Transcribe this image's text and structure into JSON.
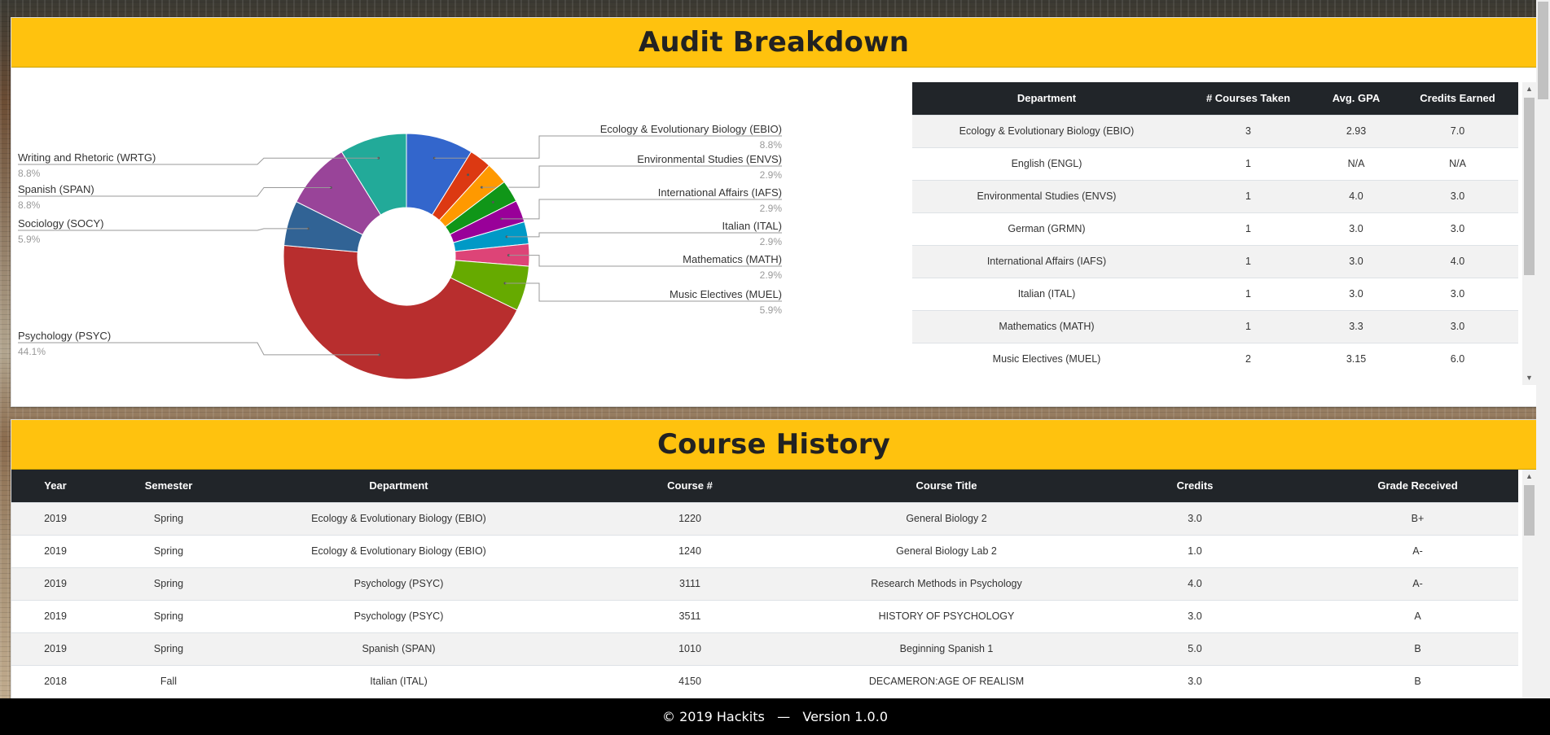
{
  "audit": {
    "title": "Audit Breakdown",
    "table": {
      "headers": [
        "Department",
        "# Courses Taken",
        "Avg. GPA",
        "Credits Earned"
      ],
      "rows": [
        [
          "Ecology & Evolutionary Biology (EBIO)",
          "3",
          "2.93",
          "7.0"
        ],
        [
          "English (ENGL)",
          "1",
          "N/A",
          "N/A"
        ],
        [
          "Environmental Studies (ENVS)",
          "1",
          "4.0",
          "3.0"
        ],
        [
          "German (GRMN)",
          "1",
          "3.0",
          "3.0"
        ],
        [
          "International Affairs (IAFS)",
          "1",
          "3.0",
          "4.0"
        ],
        [
          "Italian (ITAL)",
          "1",
          "3.0",
          "3.0"
        ],
        [
          "Mathematics (MATH)",
          "1",
          "3.3",
          "3.0"
        ],
        [
          "Music Electives (MUEL)",
          "2",
          "3.15",
          "6.0"
        ]
      ]
    }
  },
  "chart_data": {
    "type": "pie",
    "donut": true,
    "title": "",
    "legend": "none",
    "slices": [
      {
        "name": "Ecology & Evolutionary Biology (EBIO)",
        "label": "8.8%",
        "value": 8.8,
        "color": "#3366cc",
        "side": "right",
        "show_label": true
      },
      {
        "name": "English (ENGL)",
        "label": "2.9%",
        "value": 2.9,
        "color": "#dc3912",
        "side": "right",
        "show_label": false
      },
      {
        "name": "Environmental Studies (ENVS)",
        "label": "2.9%",
        "value": 2.9,
        "color": "#ff9900",
        "side": "right",
        "show_label": true
      },
      {
        "name": "German (GRMN)",
        "label": "2.9%",
        "value": 2.9,
        "color": "#109618",
        "side": "right",
        "show_label": false
      },
      {
        "name": "International Affairs (IAFS)",
        "label": "2.9%",
        "value": 2.9,
        "color": "#990099",
        "side": "right",
        "show_label": true
      },
      {
        "name": "Italian (ITAL)",
        "label": "2.9%",
        "value": 2.9,
        "color": "#0099c6",
        "side": "right",
        "show_label": true
      },
      {
        "name": "Mathematics (MATH)",
        "label": "2.9%",
        "value": 2.9,
        "color": "#dd4477",
        "side": "right",
        "show_label": true
      },
      {
        "name": "Music Electives (MUEL)",
        "label": "5.9%",
        "value": 5.9,
        "color": "#66aa00",
        "side": "right",
        "show_label": true
      },
      {
        "name": "Psychology (PSYC)",
        "label": "44.1%",
        "value": 44.1,
        "color": "#b82e2e",
        "side": "left",
        "show_label": true
      },
      {
        "name": "Sociology (SOCY)",
        "label": "5.9%",
        "value": 5.9,
        "color": "#316395",
        "side": "left",
        "show_label": true
      },
      {
        "name": "Spanish (SPAN)",
        "label": "8.8%",
        "value": 8.8,
        "color": "#994499",
        "side": "left",
        "show_label": true
      },
      {
        "name": "Writing and Rhetoric (WRTG)",
        "label": "8.8%",
        "value": 8.8,
        "color": "#22aa99",
        "side": "left",
        "show_label": true
      }
    ]
  },
  "history": {
    "title": "Course History",
    "headers": [
      "Year",
      "Semester",
      "Department",
      "Course #",
      "Course Title",
      "Credits",
      "Grade Received"
    ],
    "rows": [
      [
        "2019",
        "Spring",
        "Ecology & Evolutionary Biology (EBIO)",
        "1220",
        "General Biology 2",
        "3.0",
        "B+"
      ],
      [
        "2019",
        "Spring",
        "Ecology & Evolutionary Biology (EBIO)",
        "1240",
        "General Biology Lab 2",
        "1.0",
        "A-"
      ],
      [
        "2019",
        "Spring",
        "Psychology (PSYC)",
        "3111",
        "Research Methods in Psychology",
        "4.0",
        "A-"
      ],
      [
        "2019",
        "Spring",
        "Psychology (PSYC)",
        "3511",
        "HISTORY OF PSYCHOLOGY",
        "3.0",
        "A"
      ],
      [
        "2019",
        "Spring",
        "Spanish (SPAN)",
        "1010",
        "Beginning Spanish 1",
        "5.0",
        "B"
      ],
      [
        "2018",
        "Fall",
        "Italian (ITAL)",
        "4150",
        "DECAMERON:AGE OF REALISM",
        "3.0",
        "B"
      ]
    ]
  },
  "footer": {
    "text": "© 2019 Hackits   —   Version 1.0.0"
  }
}
